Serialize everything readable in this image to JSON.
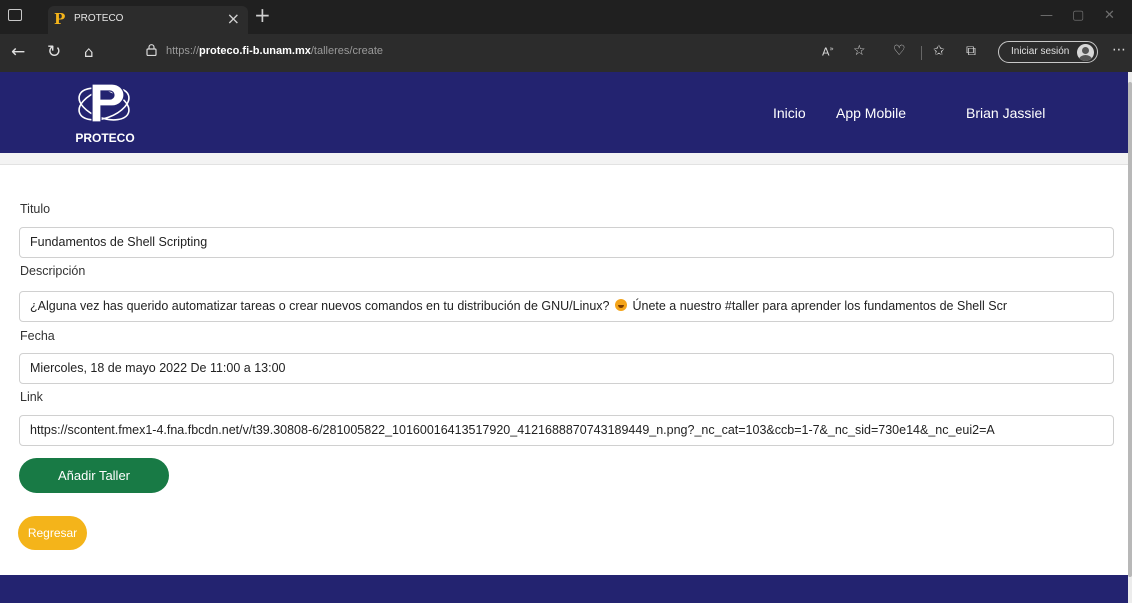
{
  "browser": {
    "tab_title": "PROTECO",
    "tab_favicon_letter": "P",
    "url_protocol": "https://",
    "url_host": "proteco.fi-b.unam.mx",
    "url_path": "/talleres/create",
    "signin_label": "Iniciar sesión"
  },
  "header": {
    "logo_text": "PROTECO",
    "nav": [
      "Inicio",
      "App Mobile",
      "Brian Jassiel"
    ]
  },
  "form": {
    "titulo_label": "Titulo",
    "titulo_value": "Fundamentos de Shell Scripting",
    "descripcion_label": "Descripción",
    "descripcion_value_before": "¿Alguna vez has querido automatizar tareas o crear nuevos comandos en tu distribución de GNU/Linux?",
    "descripcion_value_after": "Únete a nuestro #taller para aprender los fundamentos de Shell Scr",
    "fecha_label": "Fecha",
    "fecha_value": "Miercoles, 18 de mayo 2022 De 11:00 a 13:00",
    "link_label": "Link",
    "link_value": "https://scontent.fmex1-4.fna.fbcdn.net/v/t39.30808-6/281005822_10160016413517920_4121688870743189449_n.png?_nc_cat=103&ccb=1-7&_nc_sid=730e14&_nc_eui2=A",
    "submit_label": "Añadir Taller",
    "back_label": "Regresar"
  },
  "colors": {
    "header_bg": "#232370",
    "primary_green": "#187a45",
    "accent_yellow": "#f4b41a"
  }
}
